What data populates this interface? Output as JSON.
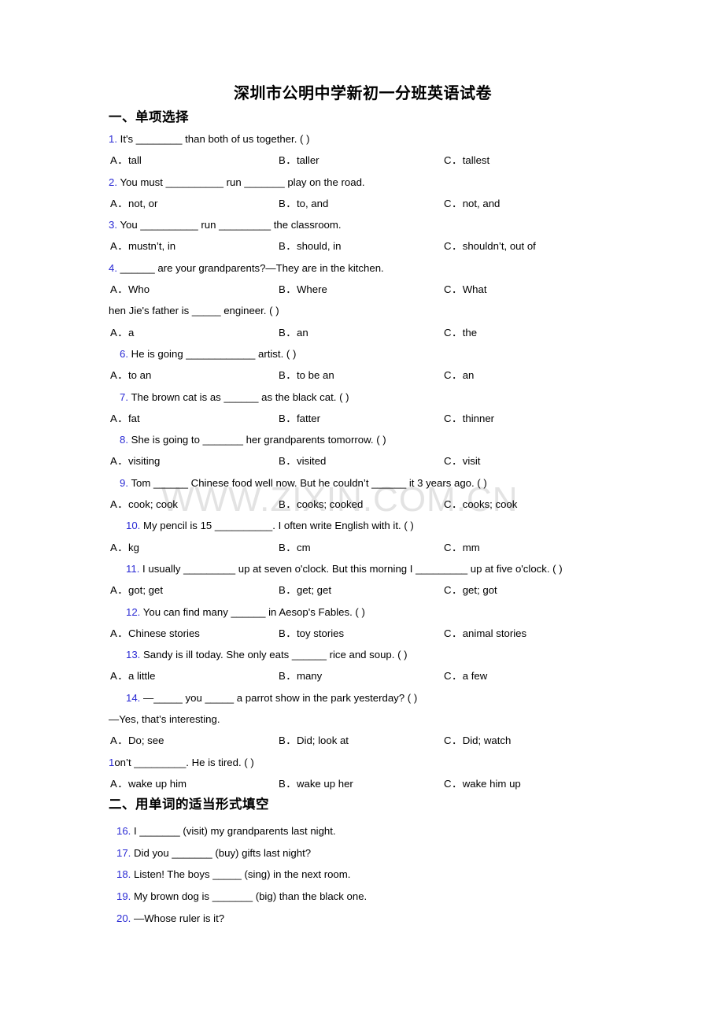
{
  "document": {
    "title": "深圳市公明中学新初一分班英语试卷",
    "watermark": "WWW.ZIXIN.COM.CN"
  },
  "sections": [
    {
      "heading": "一、单项选择",
      "questions": [
        {
          "num": "1.",
          "stem": "It's ________ than both of us together. (   )",
          "options": [
            {
              "letter": "A．",
              "text": "tall"
            },
            {
              "letter": "B．",
              "text": "taller"
            },
            {
              "letter": "C．",
              "text": "tallest"
            }
          ]
        },
        {
          "num": "2.",
          "stem": "You must __________ run _______ play on the road.",
          "options": [
            {
              "letter": "A．",
              "text": "not, or"
            },
            {
              "letter": "B．",
              "text": "to, and"
            },
            {
              "letter": "C．",
              "text": "not, and"
            }
          ]
        },
        {
          "num": "3.",
          "stem": "You __________ run _________ the classroom.",
          "options": [
            {
              "letter": "A．",
              "text": "mustn’t,  in"
            },
            {
              "letter": "B．",
              "text": "should, in"
            },
            {
              "letter": "C．",
              "text": "shouldn’t, out of"
            }
          ]
        },
        {
          "num": "4.",
          "stem": "______ are your grandparents?—They are in the kitchen.",
          "options": [
            {
              "letter": "A．",
              "text": "Who"
            },
            {
              "letter": "B．",
              "text": "Where"
            },
            {
              "letter": "C．",
              "text": "What"
            }
          ]
        },
        {
          "num": "",
          "stem": "hen Jie's father is _____ engineer. (  )",
          "options": [
            {
              "letter": "A．",
              "text": "a"
            },
            {
              "letter": "B．",
              "text": "an"
            },
            {
              "letter": "C．",
              "text": "the"
            }
          ]
        },
        {
          "num": "6.",
          "stem": "He is going ____________ artist. (  )",
          "options": [
            {
              "letter": "A．",
              "text": "to an"
            },
            {
              "letter": "B．",
              "text": "to be an"
            },
            {
              "letter": "C．",
              "text": "an"
            }
          ]
        },
        {
          "num": "7.",
          "stem": "The brown cat is as ______ as the black cat. (  )",
          "options": [
            {
              "letter": "A．",
              "text": "fat"
            },
            {
              "letter": "B．",
              "text": "fatter"
            },
            {
              "letter": "C．",
              "text": "thinner"
            }
          ]
        },
        {
          "num": "8.",
          "stem": "She is going to _______ her grandparents tomorrow. (  )",
          "options": [
            {
              "letter": "A．",
              "text": "visiting"
            },
            {
              "letter": "B．",
              "text": "visited"
            },
            {
              "letter": "C．",
              "text": "visit"
            }
          ]
        },
        {
          "num": "9.",
          "stem": "Tom ______ Chinese food well now. But he couldn’t ______ it 3 years ago. (   )",
          "options": [
            {
              "letter": "A．",
              "text": "cook; cook"
            },
            {
              "letter": "B．",
              "text": "cooks; cooked"
            },
            {
              "letter": "C．",
              "text": "cooks; cook"
            }
          ]
        },
        {
          "num": "10.",
          "stem": "My pencil is 15 __________. I often write English with it. (   )",
          "options": [
            {
              "letter": "A．",
              "text": "kg"
            },
            {
              "letter": "B．",
              "text": "cm"
            },
            {
              "letter": "C．",
              "text": "mm"
            }
          ]
        },
        {
          "num": "11.",
          "stem": "I usually _________ up at seven o'clock. But this morning I _________ up at five o'clock. (   )",
          "options": [
            {
              "letter": "A．",
              "text": "got; get"
            },
            {
              "letter": "B．",
              "text": "get; get"
            },
            {
              "letter": "C．",
              "text": "get; got"
            }
          ]
        },
        {
          "num": "12.",
          "stem": "You can find many ______ in Aesop's Fables. (  )",
          "options": [
            {
              "letter": "A．",
              "text": "Chinese stories"
            },
            {
              "letter": "B．",
              "text": "toy stories"
            },
            {
              "letter": "C．",
              "text": "animal stories"
            }
          ]
        },
        {
          "num": "13.",
          "stem": "Sandy is ill today. She only eats ______ rice and soup. (  )",
          "options": [
            {
              "letter": "A．",
              "text": "a little"
            },
            {
              "letter": "B．",
              "text": "many"
            },
            {
              "letter": "C．",
              "text": "a few"
            }
          ]
        },
        {
          "num": "14.",
          "stem": "—_____ you _____ a parrot show in the park yesterday? (  )",
          "stem2": "—Yes, that’s interesting.",
          "options": [
            {
              "letter": "A．",
              "text": "Do; see"
            },
            {
              "letter": "B．",
              "text": "Did; look at"
            },
            {
              "letter": "C．",
              "text": "Did; watch"
            }
          ]
        },
        {
          "num": "1",
          "stem": "on’t _________. He is tired. (  )",
          "options": [
            {
              "letter": "A．",
              "text": "wake up him"
            },
            {
              "letter": "B．",
              "text": "wake up her"
            },
            {
              "letter": "C．",
              "text": "wake him up"
            }
          ]
        }
      ]
    },
    {
      "heading": "二、用单词的适当形式填空",
      "fill_questions": [
        {
          "num": "16.",
          "text": "I _______ (visit) my grandparents last night."
        },
        {
          "num": "17.",
          "text": "Did you _______ (buy) gifts last night?"
        },
        {
          "num": "18.",
          "text": "Listen! The boys _____ (sing) in the next room."
        },
        {
          "num": "19.",
          "text": "My brown dog is _______ (big) than the black one."
        },
        {
          "num": "20.",
          "text": "—Whose ruler is it?"
        }
      ]
    }
  ],
  "colors": {
    "question_number": "#2a2ad4",
    "text": "#000000",
    "watermark": "#e3e3e3",
    "background": "#ffffff"
  }
}
